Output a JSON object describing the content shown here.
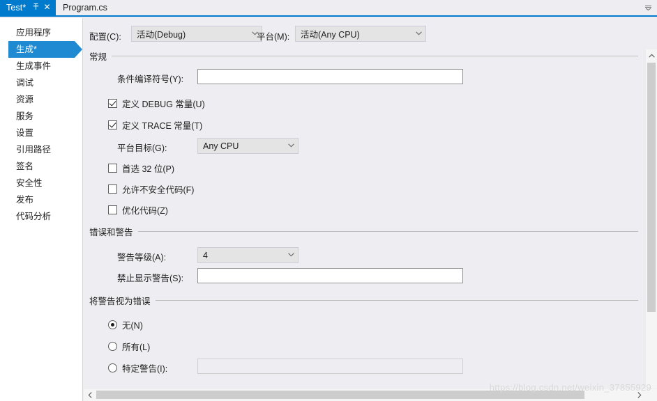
{
  "window": {
    "tabs": [
      {
        "label": "Test*",
        "active": true,
        "pin_icon": "pin-icon",
        "close_icon": "close-icon"
      },
      {
        "label": "Program.cs",
        "active": false
      }
    ],
    "tabstrip_dropdown_icon": "chevron-down-icon"
  },
  "sidebar": {
    "items": [
      {
        "label": "应用程序"
      },
      {
        "label": "生成*"
      },
      {
        "label": "生成事件"
      },
      {
        "label": "调试"
      },
      {
        "label": "资源"
      },
      {
        "label": "服务"
      },
      {
        "label": "设置"
      },
      {
        "label": "引用路径"
      },
      {
        "label": "签名"
      },
      {
        "label": "安全性"
      },
      {
        "label": "发布"
      },
      {
        "label": "代码分析"
      }
    ],
    "selected_index": 1,
    "selected_color": "#1f8ad2"
  },
  "topbar": {
    "configuration_label": "配置(C):",
    "configuration_value": "活动(Debug)",
    "platform_label": "平台(M):",
    "platform_value": "活动(Any CPU)"
  },
  "sections": {
    "general": {
      "title": "常规",
      "conditional_symbols_label": "条件编译符号(Y):",
      "conditional_symbols_value": "",
      "define_debug_label": "定义 DEBUG 常量(U)",
      "define_debug_checked": true,
      "define_trace_label": "定义 TRACE 常量(T)",
      "define_trace_checked": true,
      "platform_target_label": "平台目标(G):",
      "platform_target_value": "Any CPU",
      "prefer_32bit_label": "首选 32 位(P)",
      "prefer_32bit_checked": false,
      "allow_unsafe_label": "允许不安全代码(F)",
      "allow_unsafe_checked": false,
      "optimize_code_label": "优化代码(Z)",
      "optimize_code_checked": false
    },
    "errors_warnings": {
      "title": "错误和警告",
      "warning_level_label": "警告等级(A):",
      "warning_level_value": "4",
      "suppress_warnings_label": "禁止显示警告(S):",
      "suppress_warnings_value": ""
    },
    "treat_warnings": {
      "title": "将警告视为错误",
      "none_label": "无(N)",
      "all_label": "所有(L)",
      "specific_label": "特定警告(I):",
      "specific_value": "",
      "selected": "none"
    }
  },
  "scrollbars": {
    "vertical_up_icon": "chevron-up-icon",
    "horizontal_left_icon": "chevron-left-icon",
    "horizontal_right_icon": "chevron-right-icon"
  },
  "watermark": "https://blog.csdn.net/weixin_37855929"
}
